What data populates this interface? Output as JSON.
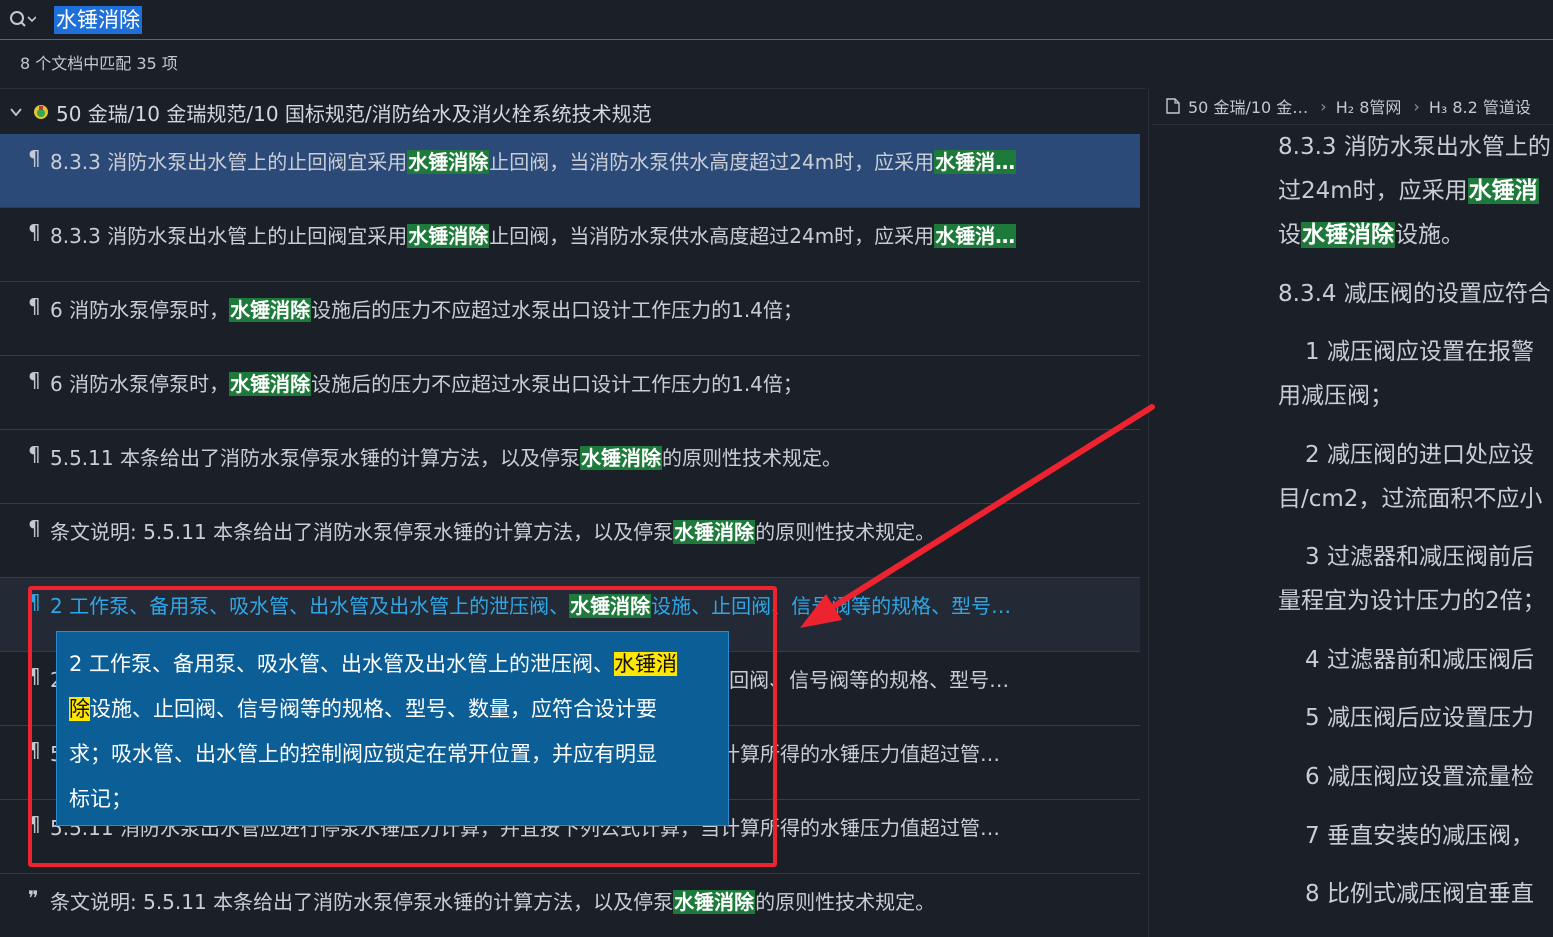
{
  "search": {
    "query": "水锤消除"
  },
  "summary": "8 个文档中匹配 35 项",
  "group": {
    "path": "50 金瑞/10 金瑞规范/10 国标规范/消防给水及消火栓系统技术规范"
  },
  "results": [
    {
      "mark": "¶",
      "pre": "8.3.3 消防水泵出水管上的止回阀宜采用",
      "hl": "水锤消除",
      "post": "止回阀，当消防水泵供水高度超过24m时，应采用",
      "hl2": "水锤消…",
      "state": "selected"
    },
    {
      "mark": "¶",
      "pre": "8.3.3 消防水泵出水管上的止回阀宜采用",
      "hl": "水锤消除",
      "post": "止回阀，当消防水泵供水高度超过24m时，应采用",
      "hl2": "水锤消…",
      "state": ""
    },
    {
      "mark": "¶",
      "pre": "6 消防水泵停泵时，",
      "hl": "水锤消除",
      "post": "设施后的压力不应超过水泵出口设计工作压力的1.4倍；",
      "hl2": "",
      "state": ""
    },
    {
      "mark": "¶",
      "pre": "6 消防水泵停泵时，",
      "hl": "水锤消除",
      "post": "设施后的压力不应超过水泵出口设计工作压力的1.4倍；",
      "hl2": "",
      "state": ""
    },
    {
      "mark": "¶",
      "pre": "5.5.11 本条给出了消防水泵停泵水锤的计算方法，以及停泵",
      "hl": "水锤消除",
      "post": "的原则性技术规定。",
      "hl2": "",
      "state": ""
    },
    {
      "mark": "¶",
      "pre": "条文说明: 5.5.11 本条给出了消防水泵停泵水锤的计算方法，以及停泵",
      "hl": "水锤消除",
      "post": "的原则性技术规定。",
      "hl2": "",
      "state": ""
    },
    {
      "mark": "¶",
      "pre": "2 工作泵、备用泵、吸水管、出水管及出水管上的泄压阀、",
      "hl": "水锤消除",
      "post": "设施、止回阀、信号阀等的规格、型号…",
      "hl2": "",
      "state": "link"
    },
    {
      "mark": "¶",
      "pre": "2 工作泵、备用泵、吸水管、出水管及出水管上的泄压阀、水锤消除设施、止回阀、信号阀等的规格、型号…",
      "hl": "",
      "post": "",
      "hl2": "",
      "state": ""
    },
    {
      "mark": "¶",
      "pre": "5.5.11 消防水泵出水管应进行停泵水锤压力计算，并宜按下列公式计算，当计算所得的水锤压力值超过管…",
      "hl": "",
      "post": "",
      "hl2": "",
      "state": ""
    },
    {
      "mark": "¶",
      "pre": "5.5.11 消防水泵出水管应进行停泵水锤压力计算，并宜按下列公式计算，当计算所得的水锤压力值超过管…",
      "hl": "",
      "post": "",
      "hl2": "",
      "state": ""
    },
    {
      "mark": "❞",
      "pre": "条文说明: 5.5.11 本条给出了消防水泵停泵水锤的计算方法，以及停泵",
      "hl": "水锤消除",
      "post": "的原则性技术规定。",
      "hl2": "",
      "state": ""
    }
  ],
  "popup": {
    "line1_pre": "2 工作泵、备用泵、吸水管、出水管及出水管上的泄压阀、",
    "line1_hl": "水锤消",
    "line2_hl": "除",
    "line2_post": "设施、止回阀、信号阀等的规格、型号、数量，应符合设计要",
    "line3": "求；吸水管、出水管上的控制阀应锁定在常开位置，并应有明显",
    "line4": "标记；"
  },
  "breadcrumb": {
    "doc": "50 金瑞/10 金…",
    "h2": "H₂ 8管网",
    "h3": "H₃ 8.2 管道设"
  },
  "preview": {
    "l1": "8.3.3 消防水泵出水管上的",
    "l2_pre": "过24m时，应采用",
    "l2_hl": "水锤消",
    "l3_pre": "设",
    "l3_hl": "水锤消除",
    "l3_post": "设施。",
    "l4": "8.3.4 减压阀的设置应符合",
    "l5": "1 减压阀应设置在报警",
    "l6": "用减压阀；",
    "l7": "2 减压阀的进口处应设",
    "l8": "目/cm2，过流面积不应小",
    "l9": "3 过滤器和减压阀前后",
    "l10": "量程宜为设计压力的2倍；",
    "l11": "4 过滤器前和减压阀后",
    "l12": "5 减压阀后应设置压力",
    "l13": "6 减压阀应设置流量检",
    "l14": "7 垂直安装的减压阀，",
    "l15": "8 比例式减压阀宜垂直"
  },
  "colors": {
    "match_highlight": "#1e7a3a",
    "popup_highlight": "#ffe600",
    "selected_row": "#2c4a78",
    "annotation_red": "#ee2330"
  }
}
